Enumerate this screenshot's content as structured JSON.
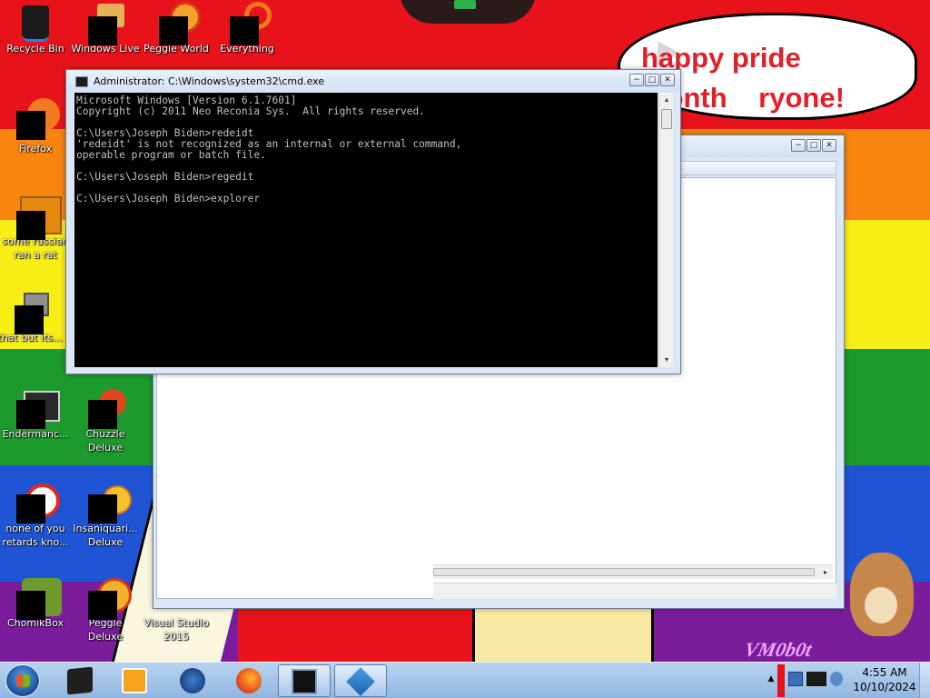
{
  "desktop": {
    "banner_text": "happy pride month    ryone!",
    "logo_text": "VM0b0t",
    "icons": [
      {
        "label": "Recycle Bin",
        "icon": "recycle-bin-icon"
      },
      {
        "label": "Windows Live",
        "icon": "windows-live-icon"
      },
      {
        "label": "Peggle World",
        "icon": "peggle-world-icon"
      },
      {
        "label": "Everything",
        "icon": "everything-icon"
      },
      {
        "label": "Firefox",
        "icon": "firefox-icon"
      },
      {
        "label": "some russian\nran a rat",
        "icon": "file-icon"
      },
      {
        "label": "that but its...",
        "icon": "shortcut-icon"
      },
      {
        "label": "Endermanc...",
        "icon": "program-icon"
      },
      {
        "label": "Chuzzle Deluxe",
        "icon": "chuzzle-icon"
      },
      {
        "label": "none of you retards kno...",
        "icon": "program-icon"
      },
      {
        "label": "Insaniquari... Deluxe",
        "icon": "insaniquarium-icon"
      },
      {
        "label": "ChomikBox",
        "icon": "chomikbox-icon"
      },
      {
        "label": "Peggle Deluxe",
        "icon": "peggle-icon"
      },
      {
        "label": "Visual Studio 2015",
        "icon": "visual-studio-icon"
      }
    ]
  },
  "cmd_window": {
    "title": "Administrator: C:\\Windows\\system32\\cmd.exe",
    "lines": [
      "Microsoft Windows [Version 6.1.7601]",
      "Copyright (c) 2011 Neo Reconia Sys.  All rights reserved.",
      "",
      "C:\\Users\\Joseph Biden>redeidt",
      "'redeidt' is not recognized as an internal or external command,",
      "operable program or batch file.",
      "",
      "C:\\Users\\Joseph Biden>regedit",
      "",
      "C:\\Users\\Joseph Biden>explorer"
    ]
  },
  "window_controls": {
    "minimize": "−",
    "maximize": "□",
    "close": "✕"
  },
  "taskbar": {
    "clock_time": "4:55 AM",
    "clock_date": "10/10/2024",
    "items": [
      {
        "name": "cmd-app",
        "icon": "terminal-icon"
      },
      {
        "name": "media-player",
        "icon": "media-player-icon"
      },
      {
        "name": "globe-app",
        "icon": "globe-icon"
      },
      {
        "name": "firefox",
        "icon": "firefox-icon"
      },
      {
        "name": "cmd-window",
        "icon": "console-icon",
        "active": true
      },
      {
        "name": "regedit-window",
        "icon": "registry-icon",
        "active": true
      }
    ]
  },
  "colors": {
    "rainbow": [
      "#e8131a",
      "#f8850f",
      "#f7ee16",
      "#1d9a2e",
      "#1f55d4",
      "#7a1c9c"
    ],
    "banner_text": "#e0202a",
    "console_bg": "#000000",
    "console_fg": "#c0c0c0"
  }
}
